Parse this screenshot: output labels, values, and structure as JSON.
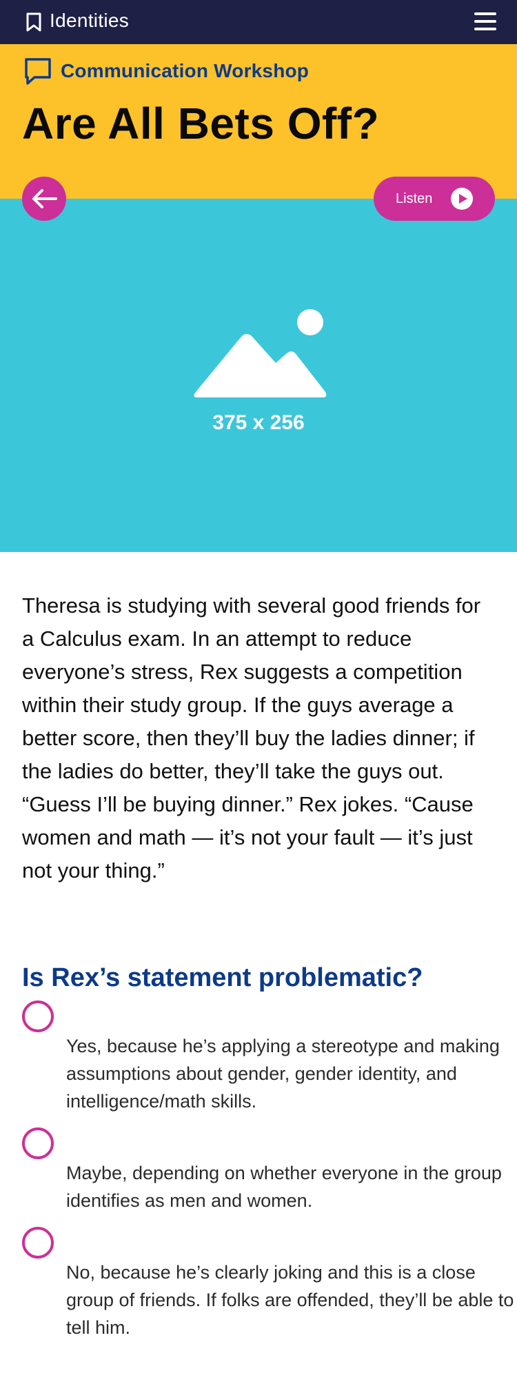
{
  "header": {
    "brand": "Identities",
    "bookmark_icon": "bookmark-icon",
    "menu_icon": "hamburger-menu-icon",
    "bg_color": "#1f2046"
  },
  "hero": {
    "category": "Communication Workshop",
    "category_icon": "speech-bubble-icon",
    "title": "Are All Bets Off?",
    "bg_color": "#fdc22a"
  },
  "controls": {
    "back_icon": "arrow-left-icon",
    "listen_label": "Listen",
    "play_icon": "play-icon",
    "accent": "#cc2f97"
  },
  "image": {
    "placeholder_icon": "image-placeholder-icon",
    "dimensions": "375 x 256",
    "bg_color": "#3cc6d9"
  },
  "scenario": "Theresa is studying with several good friends for a Calculus exam. In an attempt to reduce everyone’s stress, Rex suggests a competition within their study group. If the guys average a better score, then they’ll buy the ladies dinner; if the ladies do better, they’ll take the guys out. “Guess I’ll be buying dinner.” Rex jokes. “Cause women and math — it’s not your fault — it’s just not your thing.”",
  "question": "Is Rex’s statement problematic?",
  "options": [
    {
      "label": "Yes, because he’s applying a stereotype and making assumptions about gender, gender identity, and intelligence/math skills."
    },
    {
      "label": "Maybe, depending on whether everyone in the group identifies as men and women."
    },
    {
      "label": "No, because he’s clearly joking and this is a close group of friends. If folks are offended, they’ll be able to tell him."
    }
  ]
}
